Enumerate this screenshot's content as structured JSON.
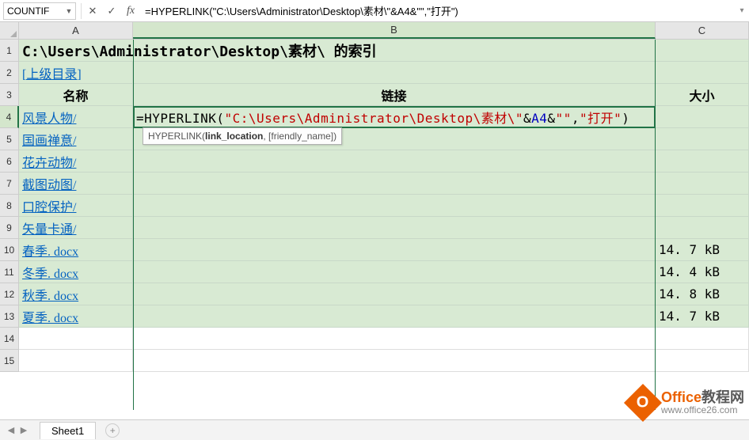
{
  "namebox": "COUNTIF",
  "formula": "=HYPERLINK(\"C:\\Users\\Administrator\\Desktop\\素材\\\"&A4&\"\",\"打开\")",
  "columns": [
    "A",
    "B",
    "C"
  ],
  "title_row": "C:\\Users\\Administrator\\Desktop\\素材\\ 的索引",
  "row2_A": "[上级目录]",
  "headers": {
    "A": "名称",
    "B": "链接",
    "C": "大小"
  },
  "editing": {
    "prefix": "=HYPERLINK(",
    "arg1a": "\"C:\\Users\\Administrator\\Desktop\\素材\\\"",
    "amp1": "&",
    "ref": "A4",
    "amp2": "&",
    "arg1b": "\"\"",
    "comma": ",",
    "arg2": "\"打开\"",
    "close": ")"
  },
  "tooltip": {
    "fn": "HYPERLINK(",
    "bold": "link_location",
    "rest": ", [friendly_name])"
  },
  "rows": [
    {
      "n": 4,
      "name": "风景人物/",
      "size": ""
    },
    {
      "n": 5,
      "name": "国画禅意/",
      "size": ""
    },
    {
      "n": 6,
      "name": "花卉动物/",
      "size": ""
    },
    {
      "n": 7,
      "name": "截图动图/",
      "size": ""
    },
    {
      "n": 8,
      "name": "口腔保护/",
      "size": ""
    },
    {
      "n": 9,
      "name": "矢量卡通/",
      "size": ""
    },
    {
      "n": 10,
      "name": "春季. docx",
      "size": "14. 7 kB"
    },
    {
      "n": 11,
      "name": "冬季. docx",
      "size": "14. 4 kB"
    },
    {
      "n": 12,
      "name": "秋季. docx",
      "size": "14. 8 kB"
    },
    {
      "n": 13,
      "name": "夏季. docx",
      "size": "14. 7 kB"
    }
  ],
  "blank_rows": [
    14,
    15
  ],
  "sheet_tab": "Sheet1",
  "watermark": {
    "line1a": "Office",
    "line1b": "教程网",
    "line2": "www.office26.com",
    "icon": "O"
  }
}
